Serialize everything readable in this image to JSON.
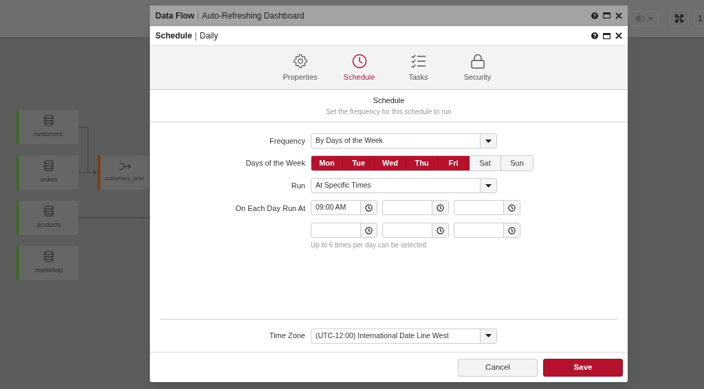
{
  "background": {
    "toolbar": {
      "zoom_label": "1"
    },
    "nodes": [
      {
        "label": "customers.",
        "kind": "source"
      },
      {
        "label": "orders",
        "kind": "source"
      },
      {
        "label": "products",
        "kind": "source"
      },
      {
        "label": "marketing",
        "kind": "source"
      },
      {
        "label": "customers_orde",
        "kind": "join"
      }
    ]
  },
  "outer_window": {
    "title_bold": "Data Flow",
    "separator": "|",
    "title": "Auto-Refreshing Dashboard"
  },
  "dialog": {
    "title_bold": "Schedule",
    "separator": "|",
    "title": "Daily",
    "tabs": [
      {
        "label": "Properties",
        "kind": "gear",
        "selected": false
      },
      {
        "label": "Schedule",
        "kind": "clock",
        "selected": true
      },
      {
        "label": "Tasks",
        "kind": "checklist",
        "selected": false
      },
      {
        "label": "Security",
        "kind": "lock",
        "selected": false
      }
    ],
    "section": {
      "title": "Schedule",
      "subtitle": "Set the frequency for this schedule to run"
    },
    "frequency": {
      "label": "Frequency",
      "value": "By Days of the Week"
    },
    "days": {
      "label": "Days of the Week",
      "items": [
        {
          "label": "Mon",
          "selected": true
        },
        {
          "label": "Tue",
          "selected": true
        },
        {
          "label": "Wed",
          "selected": true
        },
        {
          "label": "Thu",
          "selected": true
        },
        {
          "label": "Fri",
          "selected": true
        },
        {
          "label": "Sat",
          "selected": false
        },
        {
          "label": "Sun",
          "selected": false
        }
      ]
    },
    "run": {
      "label": "Run",
      "value": "At Specific Times"
    },
    "times": {
      "label": "On Each Day Run At",
      "slots": [
        {
          "kind": "filled",
          "value": "09:00 AM"
        },
        {
          "kind": "empty"
        },
        {
          "kind": "empty"
        },
        {
          "kind": "empty"
        },
        {
          "kind": "empty"
        },
        {
          "kind": "empty"
        }
      ],
      "hint": "Up to 6 times per day can be selected."
    },
    "time_zone": {
      "label": "Time Zone",
      "value": "(UTC-12:00) International Date Line West"
    },
    "buttons": [
      {
        "label": "Cancel",
        "kind": "secondary"
      },
      {
        "label": "Save",
        "kind": "primary"
      }
    ]
  }
}
